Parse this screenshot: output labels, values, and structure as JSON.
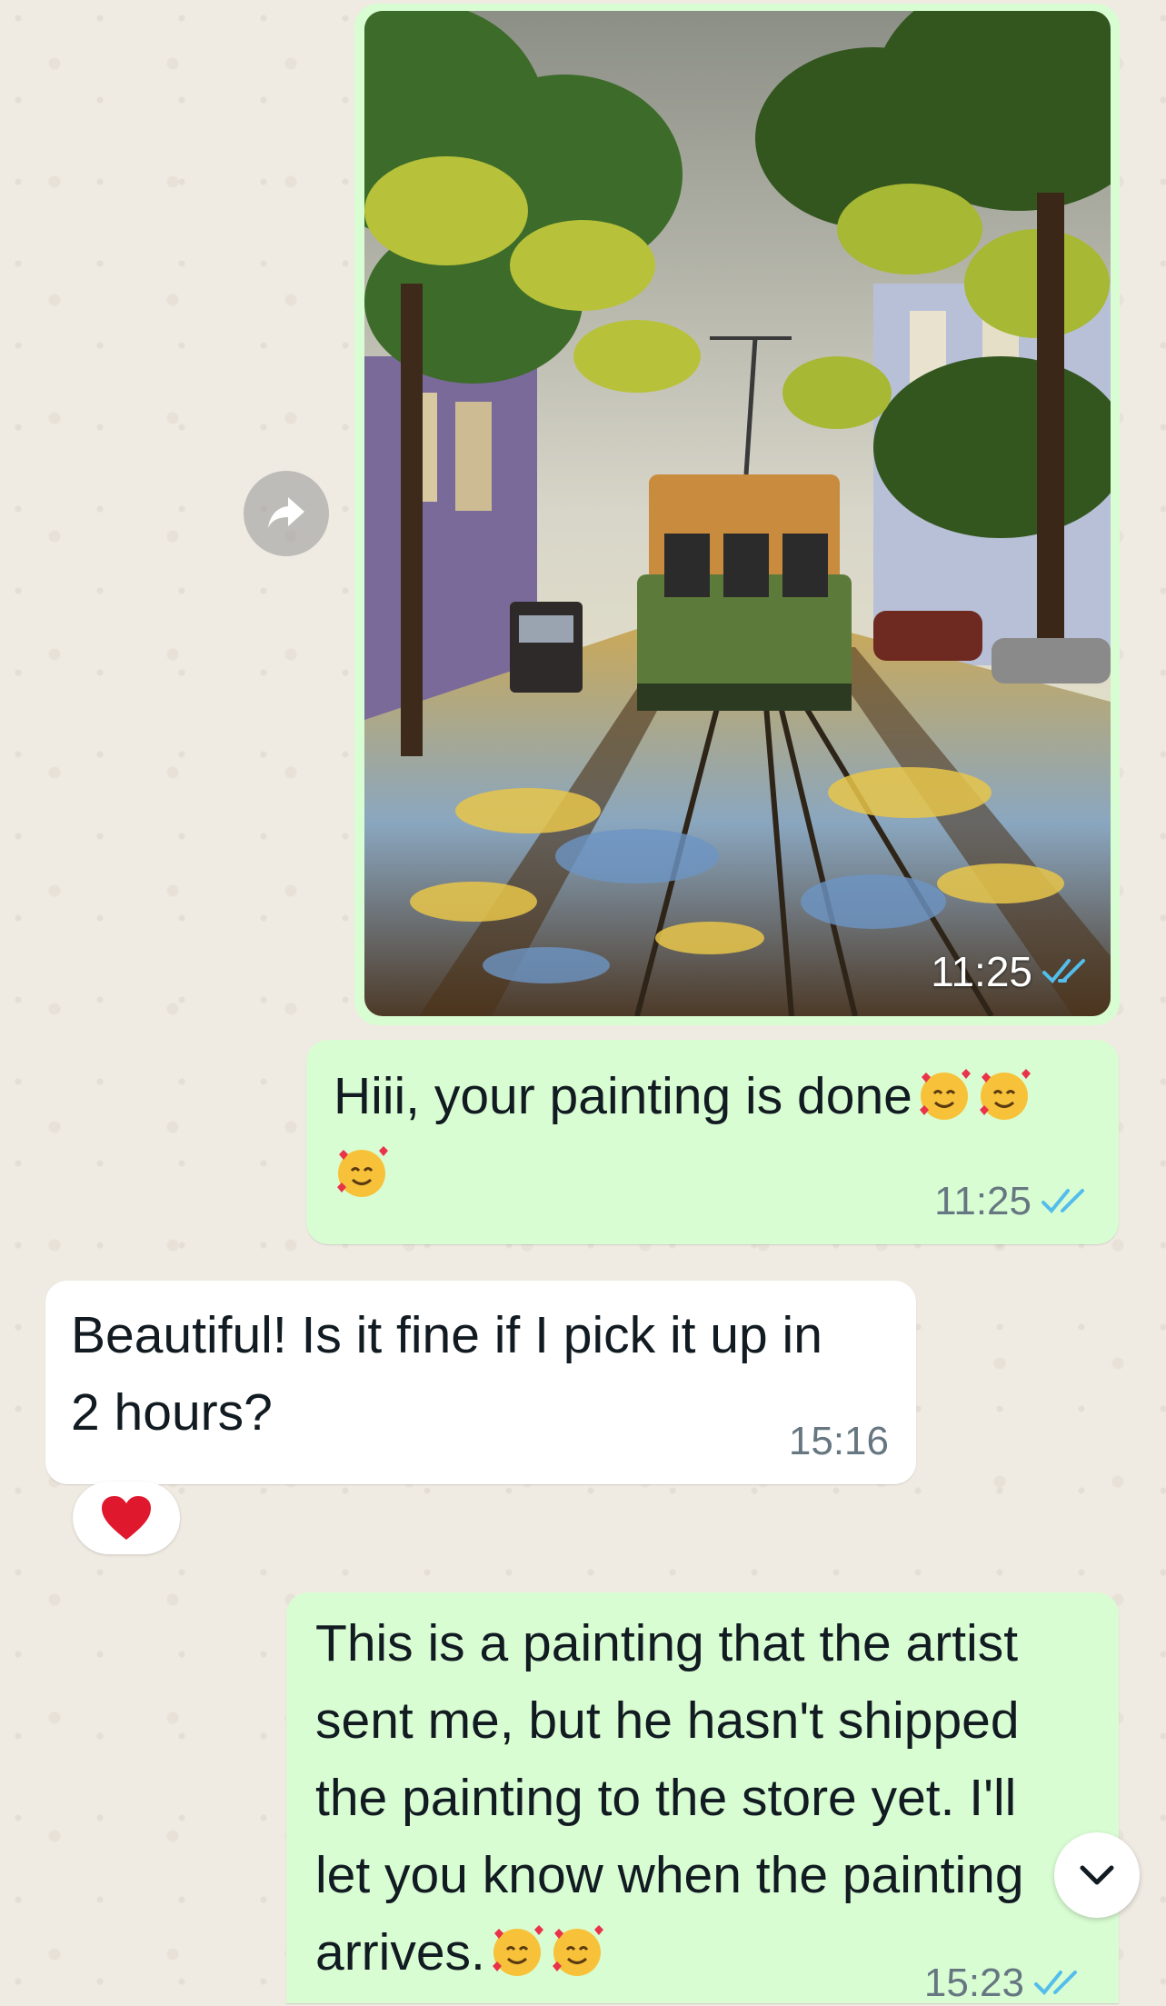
{
  "chat": {
    "messages": [
      {
        "id": "m1",
        "direction": "outgoing",
        "kind": "image",
        "image_alt": "painting of a green tram on a tree-lined street",
        "time": "11:25",
        "status": "read"
      },
      {
        "id": "m2",
        "direction": "outgoing",
        "kind": "text",
        "text": "Hiii, your painting is done",
        "emojis": [
          "smiling-face-with-hearts",
          "smiling-face-with-hearts",
          "smiling-face-with-hearts"
        ],
        "time": "11:25",
        "status": "read"
      },
      {
        "id": "m3",
        "direction": "incoming",
        "kind": "text",
        "text_line1": "Beautiful! Is it fine if I pick it up in",
        "text_line2": "2 hours?",
        "time": "15:16",
        "reaction": "red-heart"
      },
      {
        "id": "m4",
        "direction": "outgoing",
        "kind": "text",
        "lines": [
          "This is a painting that the artist",
          "sent me, but he hasn't shipped",
          "the painting to the store yet. I'll",
          "let you know when the painting",
          "arrives."
        ],
        "emojis": [
          "smiling-face-with-hearts",
          "smiling-face-with-hearts"
        ],
        "time": "15:23",
        "status": "read"
      }
    ]
  },
  "icons": {
    "forward": "forward-arrow-icon",
    "scroll": "chevron-down-icon",
    "read_receipt": "double-check-icon"
  },
  "colors": {
    "outgoing_bubble": "#d9fdd3",
    "incoming_bubble": "#ffffff",
    "read_tick": "#53bdeb",
    "wallpaper": "#efeae2"
  }
}
